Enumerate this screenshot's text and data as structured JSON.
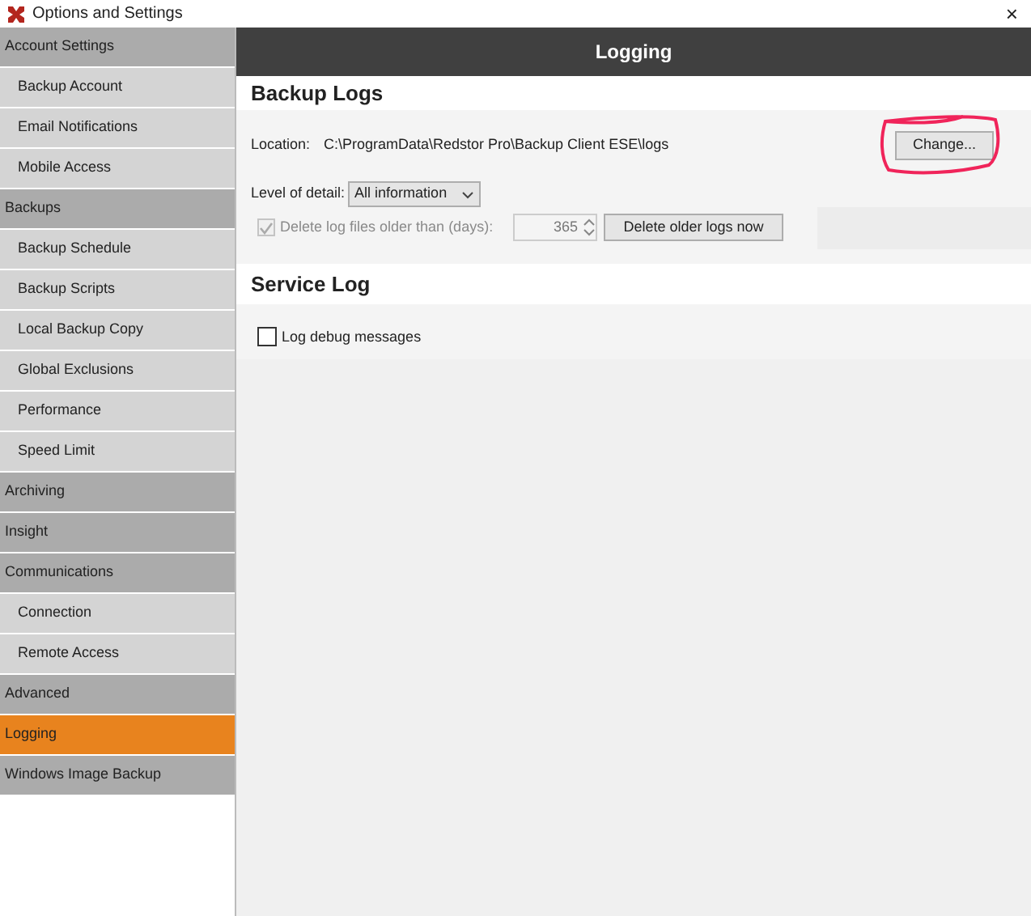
{
  "window": {
    "title": "Options and Settings",
    "close": "×"
  },
  "sidebar": {
    "items": [
      {
        "label": "Account Settings",
        "kind": "category",
        "selected": false
      },
      {
        "label": "Backup Account",
        "kind": "page",
        "selected": false
      },
      {
        "label": "Email Notifications",
        "kind": "page",
        "selected": false
      },
      {
        "label": "Mobile Access",
        "kind": "page",
        "selected": false
      },
      {
        "label": "Backups",
        "kind": "category",
        "selected": false
      },
      {
        "label": "Backup Schedule",
        "kind": "page",
        "selected": false
      },
      {
        "label": "Backup Scripts",
        "kind": "page",
        "selected": false
      },
      {
        "label": "Local Backup Copy",
        "kind": "page",
        "selected": false
      },
      {
        "label": "Global Exclusions",
        "kind": "page",
        "selected": false
      },
      {
        "label": "Performance",
        "kind": "page",
        "selected": false
      },
      {
        "label": "Speed Limit",
        "kind": "page",
        "selected": false
      },
      {
        "label": "Archiving",
        "kind": "category",
        "selected": false
      },
      {
        "label": "Insight",
        "kind": "category",
        "selected": false
      },
      {
        "label": "Communications",
        "kind": "category",
        "selected": false
      },
      {
        "label": "Connection",
        "kind": "page",
        "selected": false
      },
      {
        "label": "Remote Access",
        "kind": "page",
        "selected": false
      },
      {
        "label": "Advanced",
        "kind": "category",
        "selected": false
      },
      {
        "label": "Logging",
        "kind": "category",
        "selected": true
      },
      {
        "label": "Windows Image Backup",
        "kind": "category",
        "selected": false
      }
    ]
  },
  "page": {
    "title": "Logging",
    "backup_logs": {
      "heading": "Backup Logs",
      "location_label": "Location:",
      "location": "C:\\ProgramData\\Redstor Pro\\Backup Client ESE\\logs",
      "change_button": "Change...",
      "detail_label": "Level of detail:",
      "detail_value": "All information",
      "delete_option": {
        "label": "Delete log files older than (days):",
        "checked": true,
        "disabled": true
      },
      "days": "365",
      "delete_button": "Delete older logs now"
    },
    "service_log": {
      "heading": "Service Log",
      "debug": {
        "label": "Log debug messages",
        "checked": false
      }
    }
  }
}
